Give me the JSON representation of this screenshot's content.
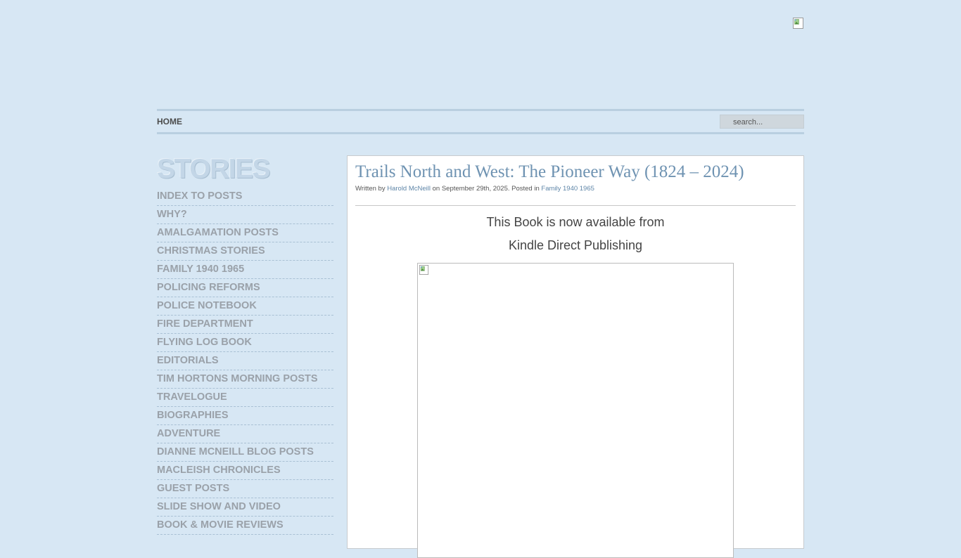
{
  "nav": {
    "home_label": "HOME",
    "search_placeholder": "search..."
  },
  "sidebar": {
    "title": "STORIES",
    "items": [
      "INDEX TO POSTS",
      "WHY?",
      "AMALGAMATION POSTS",
      "CHRISTMAS STORIES",
      "FAMILY 1940 1965",
      "POLICING REFORMS",
      "POLICE NOTEBOOK",
      "FIRE DEPARTMENT",
      "FLYING LOG BOOK",
      "EDITORIALS",
      "TIM HORTONS MORNING POSTS",
      "TRAVELOGUE",
      "BIOGRAPHIES",
      "ADVENTURE",
      "DIANNE MCNEILL BLOG POSTS",
      "MACLEISH CHRONICLES",
      "GUEST POSTS",
      "SLIDE SHOW AND VIDEO",
      "BOOK & MOVIE REVIEWS"
    ]
  },
  "post": {
    "title": "Trails North and West: The Pioneer Way (1824 – 2024)",
    "meta_prefix": "Written by ",
    "author": "Harold McNeill",
    "meta_date": " on September 29th, 2025. Posted in ",
    "category": "Family 1940 1965",
    "line1": "This Book is now available from",
    "line2": "Kindle Direct Publishing"
  },
  "icons": {
    "header_image": "broken-image-icon",
    "post_image": "broken-image-icon"
  }
}
